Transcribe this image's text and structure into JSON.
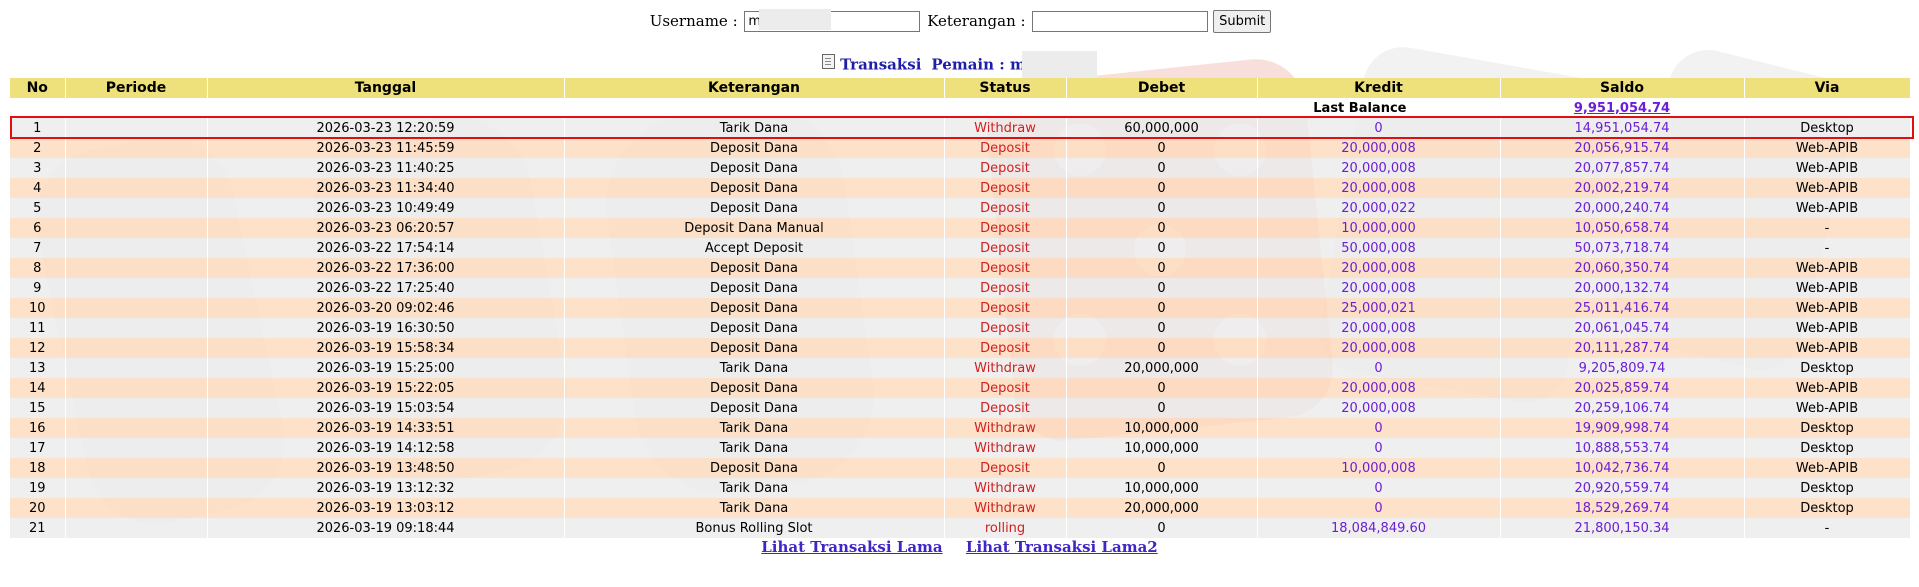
{
  "search": {
    "username_label": "Username :",
    "username_value": "m",
    "keterangan_label": "Keterangan :",
    "keterangan_value": "",
    "submit_label": "Submit"
  },
  "subtitle": {
    "transaksi": "Transaksi",
    "pemain": "Pemain : m"
  },
  "table": {
    "headers": [
      "No",
      "Periode",
      "Tanggal",
      "Keterangan",
      "Status",
      "Debet",
      "Kredit",
      "Saldo",
      "Via"
    ],
    "last_balance_label": "Last Balance",
    "last_balance_value": "9,951,054.74",
    "rows": [
      {
        "no": "1",
        "periode": "",
        "tanggal": "2026-03-23 12:20:59",
        "keterangan": "Tarik Dana",
        "status": "Withdraw",
        "debet": "60,000,000",
        "kredit": "0",
        "saldo": "14,951,054.74",
        "via": "Desktop"
      },
      {
        "no": "2",
        "periode": "",
        "tanggal": "2026-03-23 11:45:59",
        "keterangan": "Deposit Dana",
        "status": "Deposit",
        "debet": "0",
        "kredit": "20,000,008",
        "saldo": "20,056,915.74",
        "via": "Web-APIB"
      },
      {
        "no": "3",
        "periode": "",
        "tanggal": "2026-03-23 11:40:25",
        "keterangan": "Deposit Dana",
        "status": "Deposit",
        "debet": "0",
        "kredit": "20,000,008",
        "saldo": "20,077,857.74",
        "via": "Web-APIB"
      },
      {
        "no": "4",
        "periode": "",
        "tanggal": "2026-03-23 11:34:40",
        "keterangan": "Deposit Dana",
        "status": "Deposit",
        "debet": "0",
        "kredit": "20,000,008",
        "saldo": "20,002,219.74",
        "via": "Web-APIB"
      },
      {
        "no": "5",
        "periode": "",
        "tanggal": "2026-03-23 10:49:49",
        "keterangan": "Deposit Dana",
        "status": "Deposit",
        "debet": "0",
        "kredit": "20,000,022",
        "saldo": "20,000,240.74",
        "via": "Web-APIB"
      },
      {
        "no": "6",
        "periode": "",
        "tanggal": "2026-03-23 06:20:57",
        "keterangan": "Deposit Dana Manual",
        "status": "Deposit",
        "debet": "0",
        "kredit": "10,000,000",
        "saldo": "10,050,658.74",
        "via": "-"
      },
      {
        "no": "7",
        "periode": "",
        "tanggal": "2026-03-22 17:54:14",
        "keterangan": "Accept Deposit",
        "status": "Deposit",
        "debet": "0",
        "kredit": "50,000,008",
        "saldo": "50,073,718.74",
        "via": "-"
      },
      {
        "no": "8",
        "periode": "",
        "tanggal": "2026-03-22 17:36:00",
        "keterangan": "Deposit Dana",
        "status": "Deposit",
        "debet": "0",
        "kredit": "20,000,008",
        "saldo": "20,060,350.74",
        "via": "Web-APIB"
      },
      {
        "no": "9",
        "periode": "",
        "tanggal": "2026-03-22 17:25:40",
        "keterangan": "Deposit Dana",
        "status": "Deposit",
        "debet": "0",
        "kredit": "20,000,008",
        "saldo": "20,000,132.74",
        "via": "Web-APIB"
      },
      {
        "no": "10",
        "periode": "",
        "tanggal": "2026-03-20 09:02:46",
        "keterangan": "Deposit Dana",
        "status": "Deposit",
        "debet": "0",
        "kredit": "25,000,021",
        "saldo": "25,011,416.74",
        "via": "Web-APIB"
      },
      {
        "no": "11",
        "periode": "",
        "tanggal": "2026-03-19 16:30:50",
        "keterangan": "Deposit Dana",
        "status": "Deposit",
        "debet": "0",
        "kredit": "20,000,008",
        "saldo": "20,061,045.74",
        "via": "Web-APIB"
      },
      {
        "no": "12",
        "periode": "",
        "tanggal": "2026-03-19 15:58:34",
        "keterangan": "Deposit Dana",
        "status": "Deposit",
        "debet": "0",
        "kredit": "20,000,008",
        "saldo": "20,111,287.74",
        "via": "Web-APIB"
      },
      {
        "no": "13",
        "periode": "",
        "tanggal": "2026-03-19 15:25:00",
        "keterangan": "Tarik Dana",
        "status": "Withdraw",
        "debet": "20,000,000",
        "kredit": "0",
        "saldo": "9,205,809.74",
        "via": "Desktop"
      },
      {
        "no": "14",
        "periode": "",
        "tanggal": "2026-03-19 15:22:05",
        "keterangan": "Deposit Dana",
        "status": "Deposit",
        "debet": "0",
        "kredit": "20,000,008",
        "saldo": "20,025,859.74",
        "via": "Web-APIB"
      },
      {
        "no": "15",
        "periode": "",
        "tanggal": "2026-03-19 15:03:54",
        "keterangan": "Deposit Dana",
        "status": "Deposit",
        "debet": "0",
        "kredit": "20,000,008",
        "saldo": "20,259,106.74",
        "via": "Web-APIB"
      },
      {
        "no": "16",
        "periode": "",
        "tanggal": "2026-03-19 14:33:51",
        "keterangan": "Tarik Dana",
        "status": "Withdraw",
        "debet": "10,000,000",
        "kredit": "0",
        "saldo": "19,909,998.74",
        "via": "Desktop"
      },
      {
        "no": "17",
        "periode": "",
        "tanggal": "2026-03-19 14:12:58",
        "keterangan": "Tarik Dana",
        "status": "Withdraw",
        "debet": "10,000,000",
        "kredit": "0",
        "saldo": "10,888,553.74",
        "via": "Desktop"
      },
      {
        "no": "18",
        "periode": "",
        "tanggal": "2026-03-19 13:48:50",
        "keterangan": "Deposit Dana",
        "status": "Deposit",
        "debet": "0",
        "kredit": "10,000,008",
        "saldo": "10,042,736.74",
        "via": "Web-APIB"
      },
      {
        "no": "19",
        "periode": "",
        "tanggal": "2026-03-19 13:12:32",
        "keterangan": "Tarik Dana",
        "status": "Withdraw",
        "debet": "10,000,000",
        "kredit": "0",
        "saldo": "20,920,559.74",
        "via": "Desktop"
      },
      {
        "no": "20",
        "periode": "",
        "tanggal": "2026-03-19 13:03:12",
        "keterangan": "Tarik Dana",
        "status": "Withdraw",
        "debet": "20,000,000",
        "kredit": "0",
        "saldo": "18,529,269.74",
        "via": "Desktop"
      },
      {
        "no": "21",
        "periode": "",
        "tanggal": "2026-03-19 09:18:44",
        "keterangan": "Bonus Rolling Slot",
        "status": "rolling",
        "debet": "0",
        "kredit": "18,084,849.60",
        "saldo": "21,800,150.34",
        "via": "-"
      }
    ]
  },
  "footer": {
    "link1": "Lihat Transaksi Lama",
    "link2": "Lihat Transaksi Lama2"
  },
  "colors": {
    "header_bg": "#eee07a",
    "row_gray": "#ececec",
    "row_peach": "#fcdabc",
    "status_red": "#d01f1f",
    "amount_purple": "#6a1fd4",
    "link_blue": "#3d26c7",
    "highlight_red": "#e01010"
  }
}
